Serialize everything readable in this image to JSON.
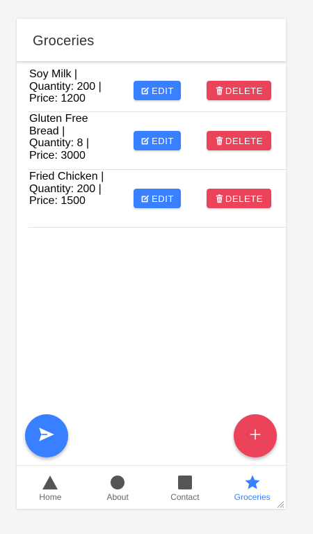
{
  "header": {
    "title": "Groceries"
  },
  "items": [
    {
      "label": "Soy Milk | Quantity: 200 | Price: 1200",
      "edit_label": "EDIT",
      "delete_label": "DELETE"
    },
    {
      "label": "Gluten Free Bread | Quantity: 8 | Price: 3000",
      "edit_label": "EDIT",
      "delete_label": "DELETE"
    },
    {
      "label": "Fried Chicken | Quantity: 200 | Price: 1500",
      "edit_label": "EDIT",
      "delete_label": "DELETE"
    }
  ],
  "fab": {
    "left_icon": "send-icon",
    "right_icon": "add-icon"
  },
  "tabs": [
    {
      "label": "Home",
      "icon": "triangle-icon",
      "active": false
    },
    {
      "label": "About",
      "icon": "circle-icon",
      "active": false
    },
    {
      "label": "Contact",
      "icon": "square-icon",
      "active": false
    },
    {
      "label": "Groceries",
      "icon": "star-icon",
      "active": true
    }
  ],
  "colors": {
    "primary": "#3880ff",
    "danger": "#eb445a",
    "tab_inactive": "#666666"
  }
}
